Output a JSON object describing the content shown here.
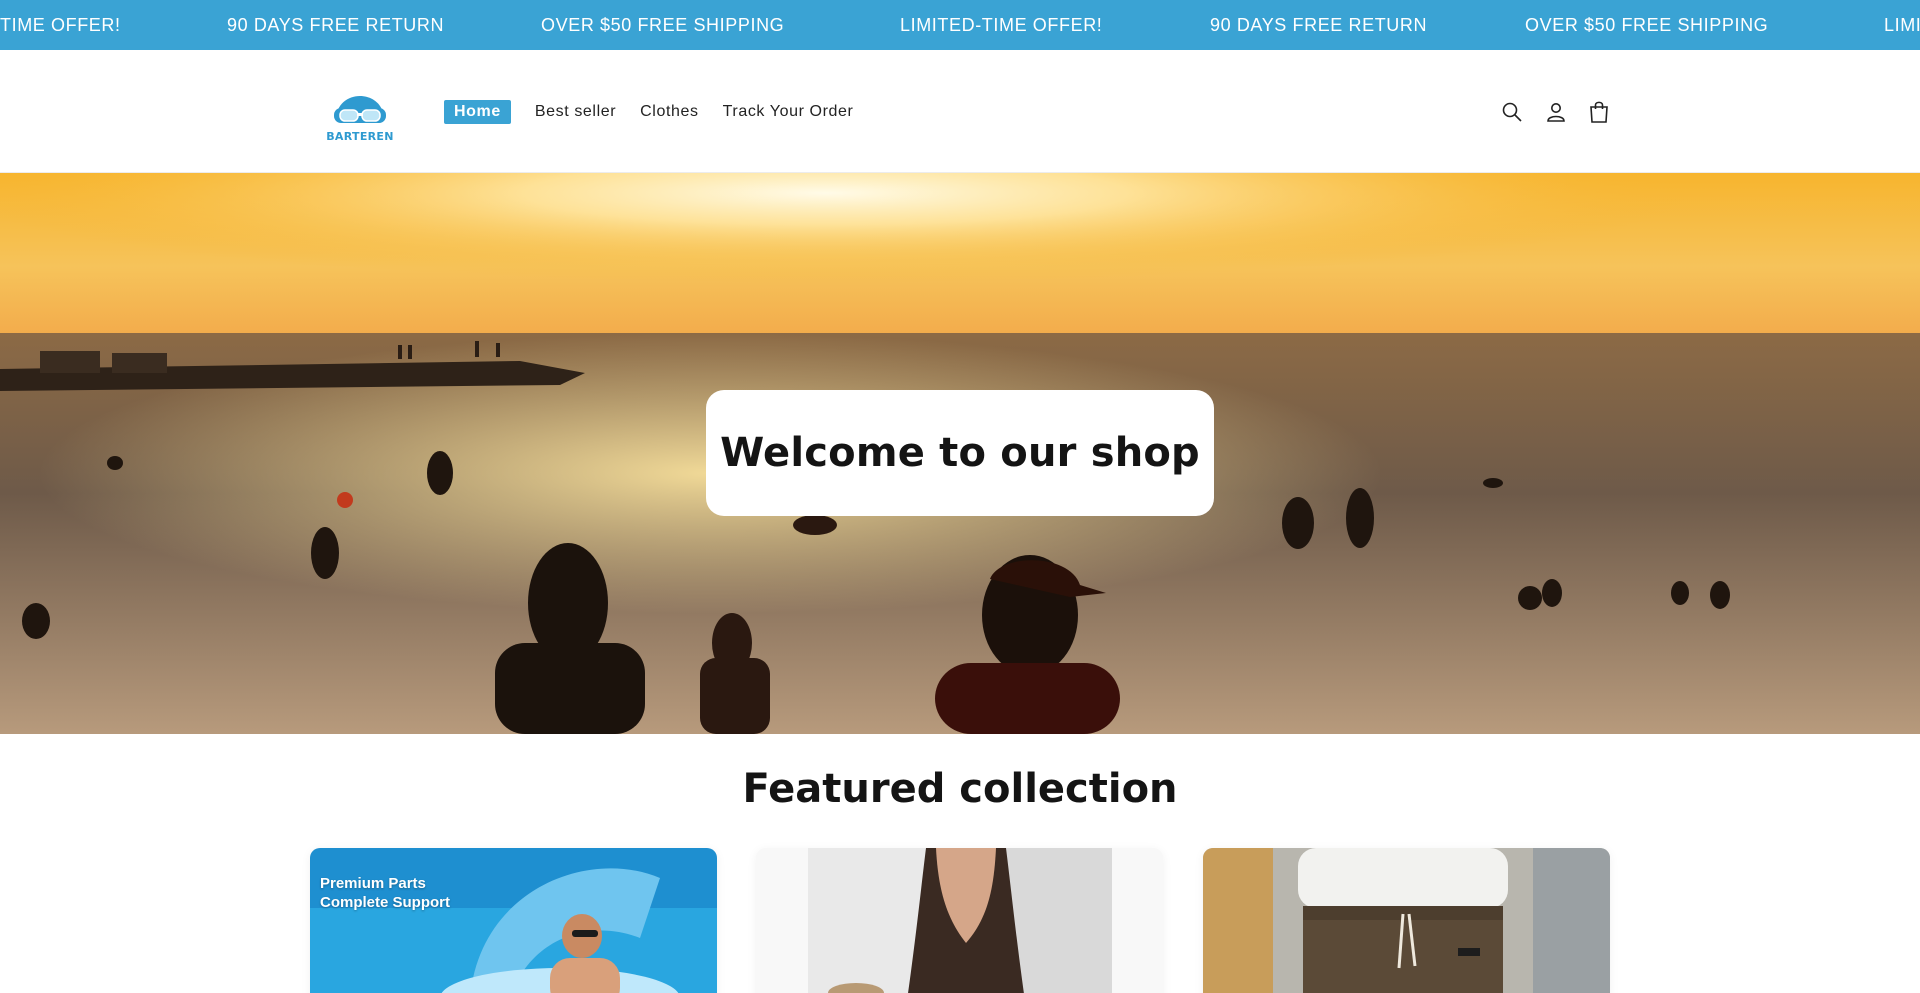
{
  "announcement": {
    "messages": [
      "TIME OFFER!",
      "90 DAYS FREE RETURN",
      "OVER $50 FREE SHIPPING",
      "LIMITED-TIME OFFER!",
      "90 DAYS FREE RETURN",
      "OVER $50 FREE SHIPPING",
      "LIMI"
    ],
    "background": "#3aa3d4"
  },
  "header": {
    "logo_text": "BARTEREN",
    "nav": [
      "Home",
      "Best seller",
      "Clothes",
      "Track Your Order"
    ],
    "active_nav": "Home",
    "icons": [
      "search-icon",
      "account-icon",
      "cart-icon"
    ]
  },
  "hero": {
    "heading": "Welcome to our shop"
  },
  "featured": {
    "title": "Featured collection",
    "products": [
      {
        "image_caption_line1": "Premium Parts",
        "image_caption_line2": "Complete Support"
      },
      {
        "image_caption_line1": "",
        "image_caption_line2": ""
      },
      {
        "image_caption_line1": "",
        "image_caption_line2": ""
      }
    ]
  },
  "colors": {
    "accent": "#3aa3d4",
    "logo": "#2e9ad0"
  }
}
